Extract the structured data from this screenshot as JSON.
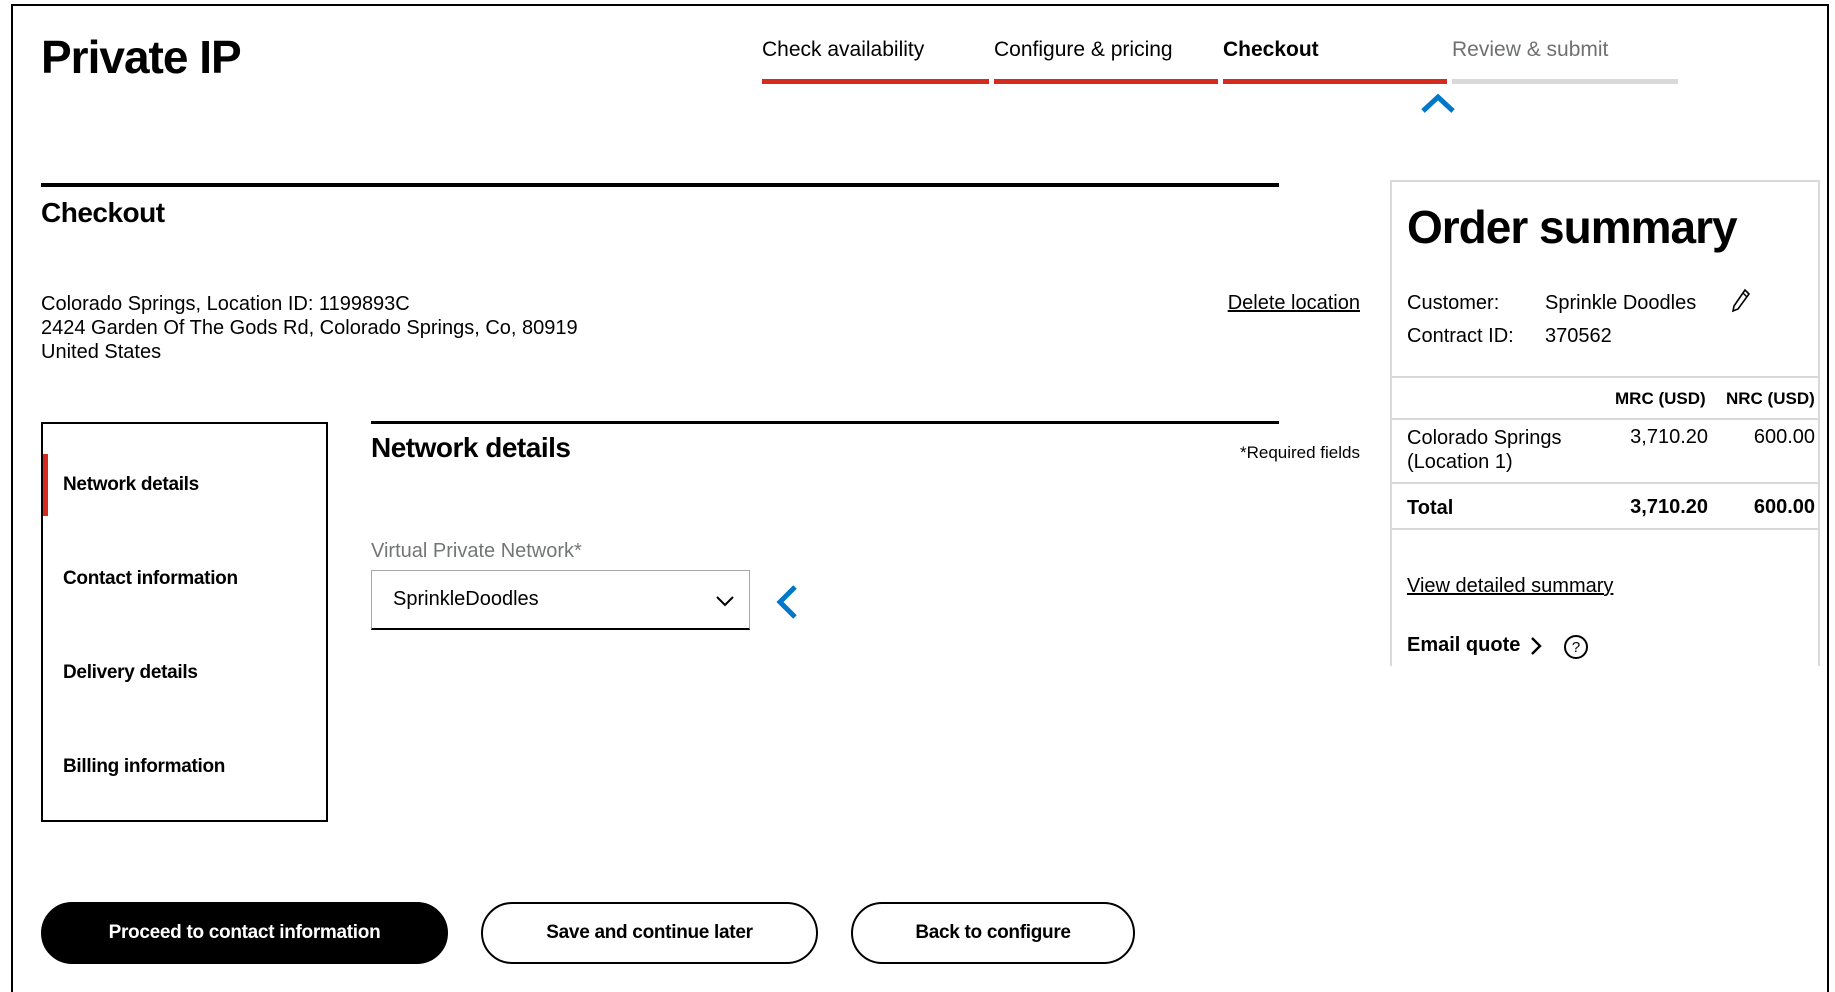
{
  "app": {
    "title": "Private IP"
  },
  "stepper": {
    "steps": [
      {
        "label": "Check availability",
        "state": "complete"
      },
      {
        "label": "Configure & pricing",
        "state": "complete"
      },
      {
        "label": "Checkout",
        "state": "current"
      },
      {
        "label": "Review & submit",
        "state": "future"
      }
    ]
  },
  "checkout": {
    "title": "Checkout",
    "location": {
      "line1": "Colorado Springs, Location ID: 1199893C",
      "line2": "2424 Garden Of The Gods Rd, Colorado Springs, Co, 80919",
      "line3": "United States",
      "delete_label": "Delete location"
    }
  },
  "side_nav": {
    "items": [
      {
        "label": "Network details",
        "active": true
      },
      {
        "label": "Contact information",
        "active": false
      },
      {
        "label": "Delivery details",
        "active": false
      },
      {
        "label": "Billing information",
        "active": false
      }
    ]
  },
  "network_details": {
    "title": "Network details",
    "required_note": "*Required fields",
    "vpn_label": "Virtual Private Network*",
    "vpn_value": "SprinkleDoodles"
  },
  "order_summary": {
    "title": "Order summary",
    "customer_label": "Customer:",
    "customer_value": "Sprinkle Doodles",
    "contract_label": "Contract ID:",
    "contract_value": "370562",
    "col_mrc": "MRC (USD)",
    "col_nrc": "NRC (USD)",
    "row": {
      "label_line1": "Colorado Springs",
      "label_line2": "(Location 1)",
      "mrc": "3,710.20",
      "nrc": "600.00"
    },
    "total": {
      "label": "Total",
      "mrc": "3,710.20",
      "nrc": "600.00"
    },
    "detail_link": "View detailed summary",
    "email_quote": "Email quote",
    "help_glyph": "?"
  },
  "actions": {
    "proceed": "Proceed to contact information",
    "save": "Save and continue later",
    "back": "Back to configure"
  },
  "colors": {
    "accent_red": "#d52b1e",
    "inactive_gray": "#d8dada",
    "caret_blue": "#0077c8"
  }
}
